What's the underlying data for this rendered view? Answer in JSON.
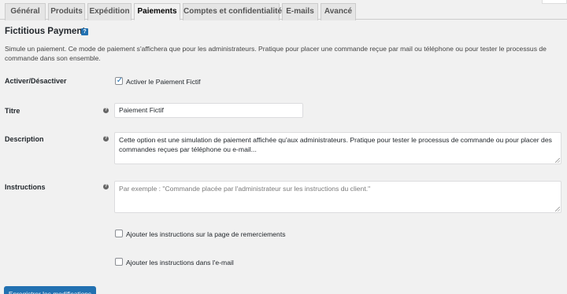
{
  "tabs": [
    {
      "label": "Général",
      "active": false
    },
    {
      "label": "Produits",
      "active": false
    },
    {
      "label": "Expédition",
      "active": false
    },
    {
      "label": "Paiements",
      "active": true
    },
    {
      "label": "Comptes et confidentialité",
      "active": false
    },
    {
      "label": "E-mails",
      "active": false
    },
    {
      "label": "Avancé",
      "active": false
    }
  ],
  "section": {
    "title": "Fictitious Payment",
    "description": "Simule un paiement. Ce mode de paiement s'affichera que pour les administrateurs. Pratique pour placer une commande reçue par mail ou téléphone ou pour tester le processus de commande dans son ensemble."
  },
  "fields": {
    "enable": {
      "label": "Activer/Désactiver",
      "checkbox_label": "Activer le Paiement Fictif",
      "checked": true
    },
    "title": {
      "label": "Titre",
      "value": "Paiement Fictif"
    },
    "description": {
      "label": "Description",
      "value": "Cette option est une simulation de paiement affichée qu'aux administrateurs. Pratique pour tester le processus de commande ou pour placer des commandes reçues par téléphone ou e-mail..."
    },
    "instructions": {
      "label": "Instructions",
      "placeholder": "Par exemple : \"Commande placée par l'administrateur sur les instructions du client.\""
    },
    "thankyou": {
      "label": "Ajouter les instructions sur la page de remerciements",
      "checked": false
    },
    "email": {
      "label": "Ajouter les instructions dans l'e-mail",
      "checked": false
    }
  },
  "save_label": "Enregistrer les modifications",
  "colors": {
    "accent": "#2271b1",
    "background": "#f1f1f1"
  },
  "icons": {
    "help": "help-icon",
    "tooltip": "question-icon",
    "check": "check-icon"
  }
}
